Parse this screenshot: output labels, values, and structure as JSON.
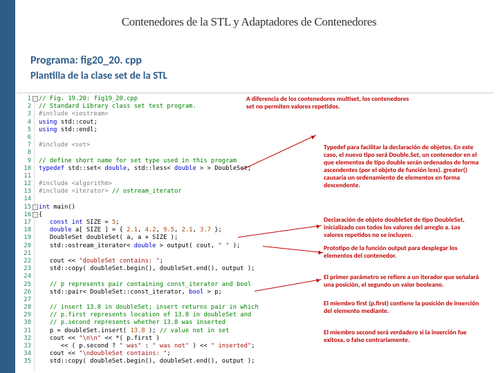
{
  "header": {
    "title": "Contenedores de la STL y Adaptadores de Contenedores"
  },
  "subhead": {
    "line1": "Programa: fig20_20. cpp",
    "line2": "Plantilla de la clase set de la STL"
  },
  "gutter": {
    "lines": [
      "1",
      "2",
      "3",
      "4",
      "5",
      "6",
      "7",
      "8",
      "9",
      "10",
      "11",
      "12",
      "13",
      "14",
      "15",
      "16",
      "17",
      "18",
      "19",
      "20",
      "21",
      "22",
      "23",
      "24",
      "25",
      "26",
      "27",
      "28",
      "29",
      "30",
      "31",
      "32",
      "33",
      "34",
      "35"
    ]
  },
  "code": {
    "l1": {
      "pre": "⊟",
      "cm": "// Fig. 19.20: fig19_20.cpp"
    },
    "l2": {
      "cm": "// Standard Library class set test program."
    },
    "l3": {
      "pp": "#include <iostream>"
    },
    "l4": {
      "kw": "using ",
      "id": "std::cout;"
    },
    "l5": {
      "kw": "using ",
      "id": "std::endl;"
    },
    "l6": {
      "txt": ""
    },
    "l7": {
      "pp": "#include <set>"
    },
    "l8": {
      "txt": ""
    },
    "l9": {
      "cm": "// define short name for set type used in this program"
    },
    "l10": {
      "kw": "typedef ",
      "id": "std::set< ",
      "kw2": "double",
      "id2": ", std::less< ",
      "kw3": "double",
      "id3": " > > DoubleSet;"
    },
    "l11": {
      "txt": ""
    },
    "l12": {
      "pp": "#include <algorithm>"
    },
    "l13": {
      "pp": "#include <iterator> ",
      "cm": "// ostream_iterator"
    },
    "l14": {
      "txt": ""
    },
    "l15": {
      "kw": "int ",
      "id": "main()"
    },
    "l16": {
      "id": "{"
    },
    "l17": {
      "kw": "   const int ",
      "id": "SIZE = ",
      "num": "5",
      "id2": ";"
    },
    "l18": {
      "kw": "   double ",
      "id": "a[ SIZE ] = { ",
      "num": "2.1",
      "id2": ", ",
      "num2": "4.2",
      "id3": ", ",
      "num3": "9.5",
      "id4": ", ",
      "num4": "2.1",
      "id5": ", ",
      "num5": "3.7",
      "id6": " };"
    },
    "l19": {
      "id": "   DoubleSet doubleSet( a, a + SIZE );"
    },
    "l20": {
      "id": "   std::ostream_iterator< ",
      "kw": "double",
      "id2": " > output( cout, ",
      "str": "\" \"",
      "id3": " );"
    },
    "l21": {
      "txt": ""
    },
    "l22": {
      "id": "   cout << ",
      "str": "\"doubleSet contains: \"",
      "id2": ";"
    },
    "l23": {
      "id": "   std::copy( doubleSet.begin(), doubleSet.end(), output );"
    },
    "l24": {
      "txt": ""
    },
    "l25": {
      "cm": "   // p represents pair containing const_iterator and bool"
    },
    "l26": {
      "id": "   std::pair< DoubleSet::const_iterator, ",
      "kw": "bool",
      "id2": " > p;"
    },
    "l27": {
      "txt": ""
    },
    "l28": {
      "cm": "   // insert 13.8 in doubleSet; insert returns pair in which"
    },
    "l29": {
      "cm": "   // p.first represents location of 13.8 in doubleSet and"
    },
    "l30": {
      "cm": "   // p.second represents whether 13.8 was inserted"
    },
    "l31": {
      "id": "   p = doubleSet.insert( ",
      "num": "13.8",
      "id2": " ); ",
      "cm": "// value not in set"
    },
    "l32": {
      "id": "   cout << ",
      "str": "\"\\n\\n\"",
      "id2": " << *( p.first )"
    },
    "l33": {
      "id": "      << ( p.second ? ",
      "str": "\" was\"",
      "id2": " : ",
      "str2": "\" was not\"",
      "id3": " ) << ",
      "str3": "\" inserted\"",
      "id4": ";"
    },
    "l34": {
      "id": "   cout << ",
      "str": "\"\\ndoubleSet contains: \"",
      "id2": ";"
    },
    "l35": {
      "id": "   std::copy( doubleSet.begin(), doubleSet.end(), output );"
    }
  },
  "annotations": {
    "a1": "A diferencia de los contenedores multiset, los contenedores set no permiten valores repetidos.",
    "a2": "Typedef para facilitar la declaración de objetos. En este caso, el nuevo tipo será Double.Set, un contenedor en el que elementos de tipo double serán ordenados de forma ascendentes (por el objeto de función less). greater() causaría un ordenamiento de elementos en forma descendente.",
    "a3": "Declaración de objeto doubleSet de tipo DoubleSet, inicializado con todos los valores del arreglo a. Los valores repetidos no se incluyen.",
    "a4": "Prototipo de la función output para desplegar los elementos del contenedor.",
    "a5": "El primer parámetro se refiere a un iterador que señalará una posición, el segundo un valor booleano.",
    "a6": "El miembro first (p.first) contiene la posición de inserción del elemento mediante.",
    "a7": "El miembro second será verdadero si la inserción fue exitosa, o falso contrariamente."
  }
}
